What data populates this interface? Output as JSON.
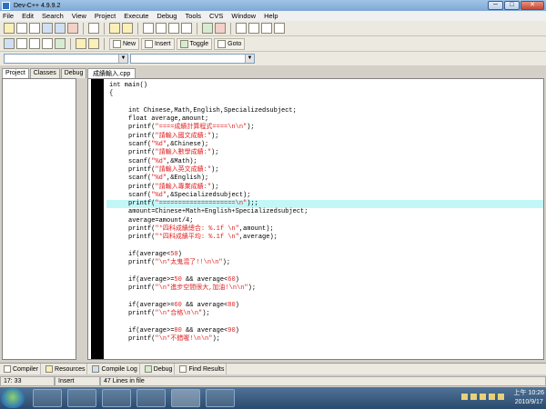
{
  "window": {
    "title": "Dev-C++ 4.9.9.2",
    "minimize": "─",
    "maximize": "□",
    "close": "✕"
  },
  "menu": [
    "File",
    "Edit",
    "Search",
    "View",
    "Project",
    "Execute",
    "Debug",
    "Tools",
    "CVS",
    "Window",
    "Help"
  ],
  "toolbar2": {
    "new_label": "New",
    "insert_label": "Insert",
    "toggle_label": "Toggle",
    "goto_label": "Goto"
  },
  "left_tabs": [
    "Project",
    "Classes",
    "Debug"
  ],
  "file_tab": "成績輸入.cpp",
  "code_lines": [
    [
      [
        "tx",
        "int main()"
      ]
    ],
    [
      [
        "tx",
        "{"
      ]
    ],
    [
      [
        "tx",
        ""
      ]
    ],
    [
      [
        "tx",
        "     int Chinese,Math,English,Specializedsubject;"
      ]
    ],
    [
      [
        "tx",
        "     float average,amount;"
      ]
    ],
    [
      [
        "tx",
        "     printf("
      ],
      [
        "st",
        "\"====成績計算程式====\\n\\n\""
      ],
      [
        "tx",
        ");"
      ]
    ],
    [
      [
        "tx",
        "     printf("
      ],
      [
        "st",
        "\"請輸入國文成績:\""
      ],
      [
        "tx",
        ");"
      ]
    ],
    [
      [
        "tx",
        "     scanf("
      ],
      [
        "st",
        "\"%d\""
      ],
      [
        "tx",
        ",&Chinese);"
      ]
    ],
    [
      [
        "tx",
        "     printf("
      ],
      [
        "st",
        "\"請輸入數學成績:\""
      ],
      [
        "tx",
        ");"
      ]
    ],
    [
      [
        "tx",
        "     scanf("
      ],
      [
        "st",
        "\"%d\""
      ],
      [
        "tx",
        ",&Math);"
      ]
    ],
    [
      [
        "tx",
        "     printf("
      ],
      [
        "st",
        "\"請輸入英文成績:\""
      ],
      [
        "tx",
        ");"
      ]
    ],
    [
      [
        "tx",
        "     scanf("
      ],
      [
        "st",
        "\"%d\""
      ],
      [
        "tx",
        ",&English);"
      ]
    ],
    [
      [
        "tx",
        "     printf("
      ],
      [
        "st",
        "\"請輸入專業成績:\""
      ],
      [
        "tx",
        ");"
      ]
    ],
    [
      [
        "tx",
        "     scanf("
      ],
      [
        "st",
        "\"%d\""
      ],
      [
        "tx",
        ",&Specializedsubject);"
      ]
    ],
    [
      [
        "tx",
        "     printf("
      ],
      [
        "st",
        "\"====================\\n\""
      ],
      [
        "tx",
        ");;"
      ]
    ],
    [
      [
        "tx",
        "     amount=Chinese+Math+English+Specializedsubject;"
      ]
    ],
    [
      [
        "tx",
        "     average=amount/4;"
      ]
    ],
    [
      [
        "tx",
        "     printf("
      ],
      [
        "st",
        "\"*四科成績總合: %.1f \\n\""
      ],
      [
        "tx",
        ",amount);"
      ]
    ],
    [
      [
        "tx",
        "     printf("
      ],
      [
        "st",
        "\"*四科成績平均: %.1f \\n\""
      ],
      [
        "tx",
        ",average);"
      ]
    ],
    [
      [
        "tx",
        ""
      ]
    ],
    [
      [
        "tx",
        "     if(average<"
      ],
      [
        "st",
        "50"
      ],
      [
        "tx",
        ")"
      ]
    ],
    [
      [
        "tx",
        "     printf("
      ],
      [
        "st",
        "\"\\n*太鬼混了!!\\n\\n\""
      ],
      [
        "tx",
        ");"
      ]
    ],
    [
      [
        "tx",
        ""
      ]
    ],
    [
      [
        "tx",
        "     if(average>="
      ],
      [
        "st",
        "50"
      ],
      [
        "tx",
        " && average<"
      ],
      [
        "st",
        "60"
      ],
      [
        "tx",
        ")"
      ]
    ],
    [
      [
        "tx",
        "     printf("
      ],
      [
        "st",
        "\"\\n*進步空間很大,加油!\\n\\n\""
      ],
      [
        "tx",
        ");"
      ]
    ],
    [
      [
        "tx",
        ""
      ]
    ],
    [
      [
        "tx",
        "     if(average>="
      ],
      [
        "st",
        "60"
      ],
      [
        "tx",
        " && average<"
      ],
      [
        "st",
        "80"
      ],
      [
        "tx",
        ")"
      ]
    ],
    [
      [
        "tx",
        "     printf("
      ],
      [
        "st",
        "\"\\n*合格\\n\\n\""
      ],
      [
        "tx",
        ");"
      ]
    ],
    [
      [
        "tx",
        ""
      ]
    ],
    [
      [
        "tx",
        "     if(average>="
      ],
      [
        "st",
        "80"
      ],
      [
        "tx",
        " && average<"
      ],
      [
        "st",
        "90"
      ],
      [
        "tx",
        ")"
      ]
    ],
    [
      [
        "tx",
        "     printf("
      ],
      [
        "st",
        "\"\\n*不錯喔!\\n\\n\""
      ],
      [
        "tx",
        ");"
      ]
    ]
  ],
  "highlighted_line": 14,
  "bottom_tabs": [
    "Compiler",
    "Resources",
    "Compile Log",
    "Debug",
    "Find Results"
  ],
  "status": {
    "position": "17: 33",
    "mode": "Insert",
    "lines": "47 Lines in file"
  },
  "taskbar": {
    "time": "上午 10:26",
    "date": "2010/9/17"
  },
  "colors": {
    "string": "#e01e1e",
    "highlight": "#c2f7f8",
    "gutter": "#000000"
  }
}
